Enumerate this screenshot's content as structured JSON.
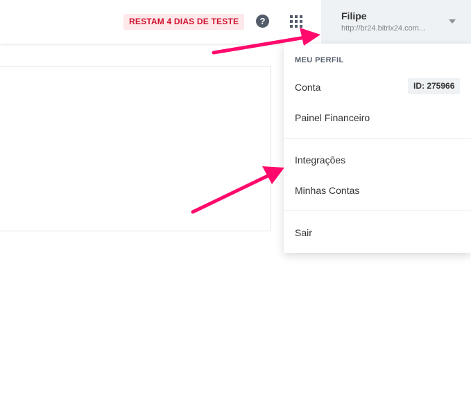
{
  "header": {
    "trial_badge": "RESTAM 4 DIAS DE TESTE",
    "help_icon": "question-circle-icon",
    "apps_icon": "grid-apps-icon"
  },
  "user": {
    "name": "Filipe",
    "url": "http://br24.bitrix24.com..."
  },
  "menu": {
    "section_title": "MEU PERFIL",
    "items": [
      {
        "label": "Conta",
        "badge": "ID: 275966"
      },
      {
        "label": "Painel Financeiro"
      },
      {
        "label": "Integrações"
      },
      {
        "label": "Minhas Contas"
      },
      {
        "label": "Sair"
      }
    ]
  },
  "colors": {
    "trial_badge_bg": "#fde8ea",
    "trial_badge_text": "#d0122e",
    "annotation_arrow": "#ff0a6c"
  }
}
